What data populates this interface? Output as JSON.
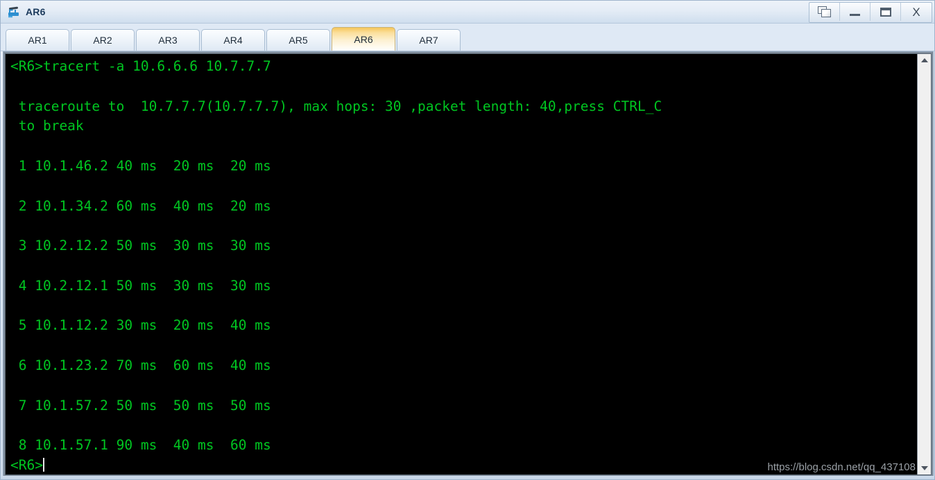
{
  "window": {
    "title": "AR6",
    "icon": "router-icon",
    "controls": [
      {
        "name": "restore-window-button",
        "icon": "cascade-windows-icon",
        "label": ""
      },
      {
        "name": "minimize-button",
        "icon": "minimize-icon",
        "label": ""
      },
      {
        "name": "maximize-button",
        "icon": "maximize-icon",
        "label": ""
      },
      {
        "name": "close-button",
        "icon": "close-icon",
        "label": "X"
      }
    ]
  },
  "tabs": {
    "active": "AR6",
    "items": [
      {
        "label": "AR1"
      },
      {
        "label": "AR2"
      },
      {
        "label": "AR3"
      },
      {
        "label": "AR4"
      },
      {
        "label": "AR5"
      },
      {
        "label": "AR6"
      },
      {
        "label": "AR7"
      }
    ]
  },
  "terminal": {
    "foreground": "#00c621",
    "background": "#000000",
    "lines": [
      "<R6>tracert -a 10.6.6.6 10.7.7.7",
      "",
      " traceroute to  10.7.7.7(10.7.7.7), max hops: 30 ,packet length: 40,press CTRL_C",
      " to break",
      "",
      " 1 10.1.46.2 40 ms  20 ms  20 ms",
      "",
      " 2 10.1.34.2 60 ms  40 ms  20 ms",
      "",
      " 3 10.2.12.2 50 ms  30 ms  30 ms",
      "",
      " 4 10.2.12.1 50 ms  30 ms  30 ms",
      "",
      " 5 10.1.12.2 30 ms  20 ms  40 ms",
      "",
      " 6 10.1.23.2 70 ms  60 ms  40 ms",
      "",
      " 7 10.1.57.2 50 ms  50 ms  50 ms",
      "",
      " 8 10.1.57.1 90 ms  40 ms  60 ms"
    ],
    "prompt": "<R6>",
    "command": "tracert -a 10.6.6.6 10.7.7.7",
    "source_address": "10.6.6.6",
    "destination_address": "10.7.7.7",
    "max_hops": "30",
    "packet_length": "40",
    "hops": [
      {
        "hop": "1",
        "address": "10.1.46.2",
        "rtt1": "40 ms",
        "rtt2": "20 ms",
        "rtt3": "20 ms"
      },
      {
        "hop": "2",
        "address": "10.1.34.2",
        "rtt1": "60 ms",
        "rtt2": "40 ms",
        "rtt3": "20 ms"
      },
      {
        "hop": "3",
        "address": "10.2.12.2",
        "rtt1": "50 ms",
        "rtt2": "30 ms",
        "rtt3": "30 ms"
      },
      {
        "hop": "4",
        "address": "10.2.12.1",
        "rtt1": "50 ms",
        "rtt2": "30 ms",
        "rtt3": "30 ms"
      },
      {
        "hop": "5",
        "address": "10.1.12.2",
        "rtt1": "30 ms",
        "rtt2": "20 ms",
        "rtt3": "40 ms"
      },
      {
        "hop": "6",
        "address": "10.1.23.2",
        "rtt1": "70 ms",
        "rtt2": "60 ms",
        "rtt3": "40 ms"
      },
      {
        "hop": "7",
        "address": "10.1.57.2",
        "rtt1": "50 ms",
        "rtt2": "50 ms",
        "rtt3": "50 ms"
      },
      {
        "hop": "8",
        "address": "10.1.57.1",
        "rtt1": "90 ms",
        "rtt2": "40 ms",
        "rtt3": "60 ms"
      }
    ]
  },
  "watermark": {
    "text": "https://blog.csdn.net/qq_437108"
  },
  "scrollbar": {
    "up_icon": "chevron-up-icon",
    "down_icon": "chevron-down-icon"
  }
}
